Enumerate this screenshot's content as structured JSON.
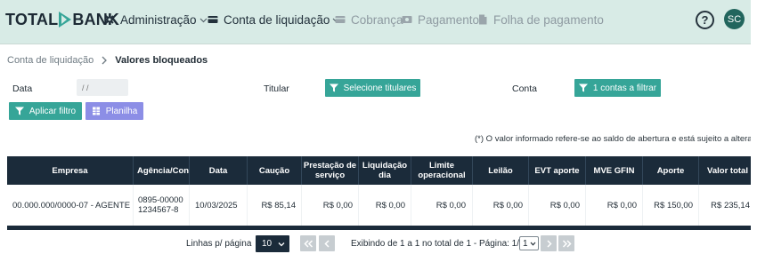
{
  "brand": {
    "left": "TOTAL",
    "right": "BANK"
  },
  "nav": [
    {
      "label": "Administração",
      "icon": "gear-icon",
      "has_dropdown": true,
      "state": "active"
    },
    {
      "label": "Conta de liquidação",
      "icon": "card-icon",
      "has_dropdown": true,
      "state": "active"
    },
    {
      "label": "Cobrança",
      "icon": "invoice-icon",
      "has_dropdown": false,
      "state": "disabled"
    },
    {
      "label": "Pagamento",
      "icon": "payment-icon",
      "has_dropdown": false,
      "state": "disabled"
    },
    {
      "label": "Folha de pagamento",
      "icon": "document-icon",
      "has_dropdown": false,
      "state": "disabled"
    }
  ],
  "header_actions": {
    "help_label": "?",
    "avatar_initials": "SC"
  },
  "breadcrumb": {
    "parent": "Conta de liquidação",
    "current": "Valores bloqueados"
  },
  "filters": {
    "date_label": "Data",
    "date_placeholder": "/ /",
    "titular_label": "Titular",
    "titular_button": "Selecione titulares",
    "conta_label": "Conta",
    "conta_button": "1 contas a filtrar",
    "apply_button": "Aplicar filtro",
    "sheet_button": "Planilha"
  },
  "note": "(*) O valor informado refere-se ao saldo de abertura e está sujeito a alteração.",
  "table": {
    "columns": [
      "Empresa",
      "Agência/Conta",
      "Data",
      "Caução",
      "Prestação de serviço",
      "Liquidação dia",
      "Limite operacional",
      "Leilão",
      "EVT aporte",
      "MVE GFIN",
      "Aporte",
      "Valor total"
    ],
    "rows": [
      {
        "empresa": "00.000.000/0000-07 - AGENTE",
        "agencia_conta": "0895-000001234567-8",
        "data": "10/03/2025",
        "caucao": "R$ 85,14",
        "prestacao": "R$ 0,00",
        "liquidacao": "R$ 0,00",
        "limite": "R$ 0,00",
        "leilao": "R$ 0,00",
        "evt_aporte": "R$ 0,00",
        "mve_gfin": "R$ 0,00",
        "aporte": "R$ 150,00",
        "valor_total": "R$ 235,14"
      }
    ]
  },
  "pagination": {
    "rows_label": "Linhas p/ página",
    "rows_value": "10",
    "info": "Exibindo de 1 a 1 no total de 1 - Página: 1/1",
    "page_value": "1"
  },
  "colors": {
    "topbar": "#d8ebe6",
    "teal": "#36a598",
    "purple": "#8c8ee6",
    "table_header": "#1b2b3a"
  }
}
